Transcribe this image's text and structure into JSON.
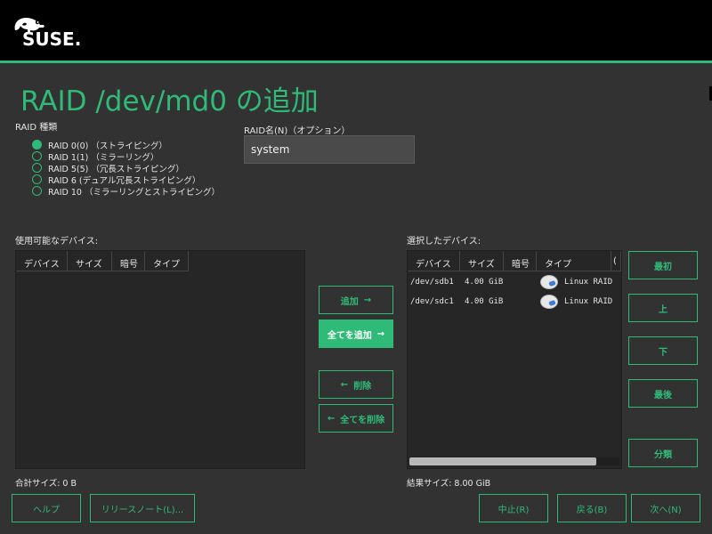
{
  "brand": {
    "name": "SUSE."
  },
  "page_title": "RAID /dev/md0 の追加",
  "raid_type": {
    "label": "RAID 種類",
    "options": [
      {
        "label": "RAID 0(0) （ストライピング）",
        "selected": true
      },
      {
        "label": "RAID 1(1) （ミラーリング）",
        "selected": false
      },
      {
        "label": "RAID 5(5) （冗長ストライピング）",
        "selected": false
      },
      {
        "label": "RAID 6 (デュアル冗長ストライピング）",
        "selected": false
      },
      {
        "label": "RAID 10 （ミラーリングとストライピング）",
        "selected": false
      }
    ]
  },
  "raid_name": {
    "label": "RAID名(N)（オプション）",
    "value": "system"
  },
  "available": {
    "label": "使用可能なデバイス:",
    "columns": [
      "デバイス",
      "サイズ",
      "暗号",
      "タイプ"
    ],
    "rows": [],
    "total": "合計サイズ: 0 B"
  },
  "selected": {
    "label": "選択したデバイス:",
    "columns": [
      "デバイス",
      "サイズ",
      "暗号",
      "タイプ",
      "("
    ],
    "rows": [
      {
        "device": "/dev/sdb1",
        "size": "4.00 GiB",
        "type": "Linux RAID",
        "icon": "disk-icon"
      },
      {
        "device": "/dev/sdc1",
        "size": "4.00 GiB",
        "type": "Linux RAID",
        "icon": "disk-icon"
      }
    ],
    "total": "結果サイズ: 8.00 GiB",
    "scroll_fraction": 0.89
  },
  "actions": {
    "add": "追加",
    "add_all": "全てを追加",
    "remove": "削除",
    "remove_all": "全てを削除",
    "arrow_right": "→",
    "arrow_left": "←"
  },
  "order": {
    "top": "最初",
    "up": "上",
    "down": "下",
    "bottom": "最後",
    "classify": "分類"
  },
  "footer": {
    "help": "ヘルプ",
    "release_notes": "リリースノート(L)...",
    "abort": "中止(R)",
    "back": "戻る(B)",
    "next": "次へ(N)"
  },
  "colors": {
    "accent": "#30ba78",
    "background": "#323232",
    "panel": "#262626",
    "topbar": "#000000"
  }
}
